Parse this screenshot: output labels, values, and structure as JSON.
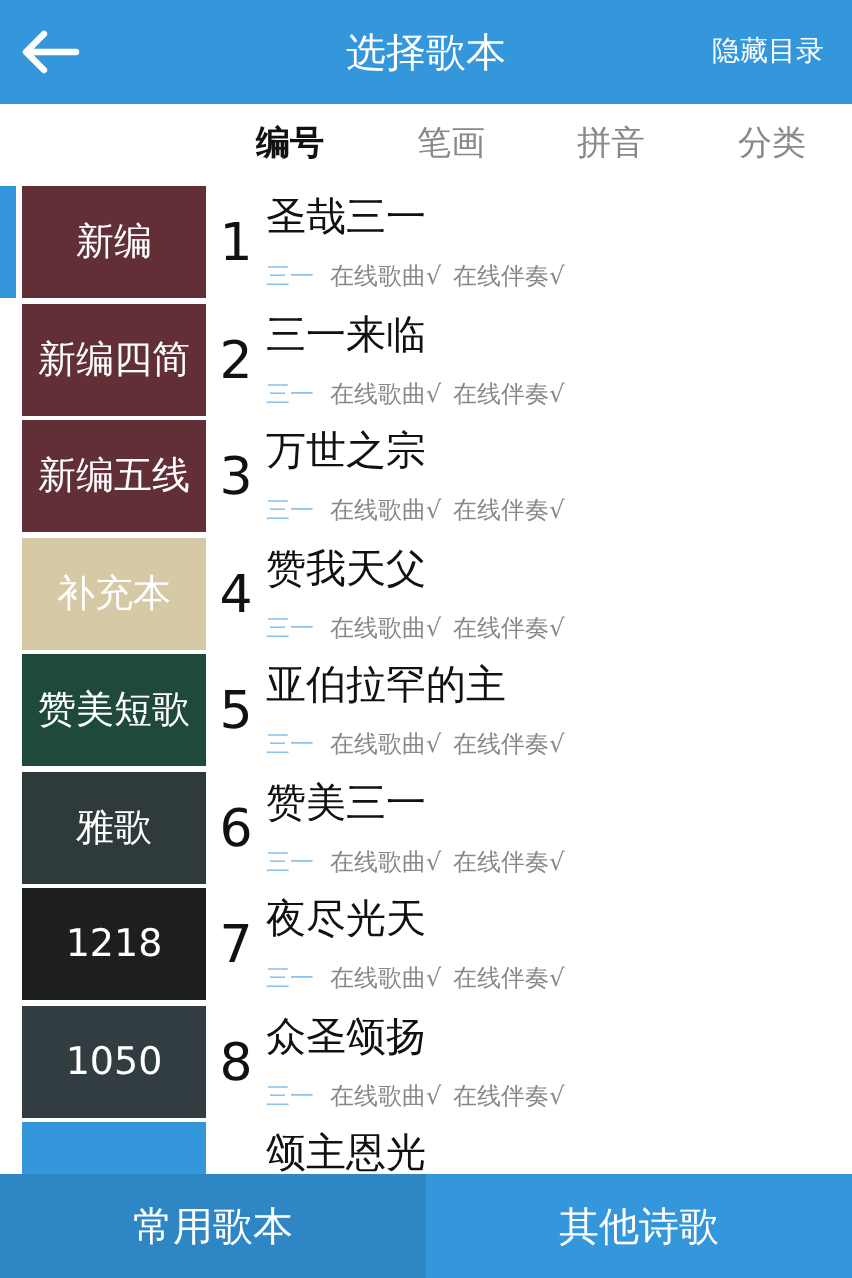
{
  "header": {
    "title": "选择歌本",
    "action": "隐藏目录"
  },
  "sort_tabs": [
    {
      "label": "编号",
      "selected": true
    },
    {
      "label": "笔画",
      "selected": false
    },
    {
      "label": "拼音",
      "selected": false
    },
    {
      "label": "分类",
      "selected": false
    }
  ],
  "books": [
    {
      "label": "新编",
      "color": "#622f37",
      "selected": true
    },
    {
      "label": "新编四简",
      "color": "#622f37",
      "selected": false
    },
    {
      "label": "新编五线",
      "color": "#622f37",
      "selected": false
    },
    {
      "label": "补充本",
      "color": "#d6caa6",
      "selected": false
    },
    {
      "label": "赞美短歌",
      "color": "#1f4a3a",
      "selected": false
    },
    {
      "label": "雅歌",
      "color": "#2f3b3b",
      "selected": false
    },
    {
      "label": "1218",
      "color": "#1d1f1e",
      "selected": false
    },
    {
      "label": "1050",
      "color": "#323d42",
      "selected": false
    },
    {
      "color": "#3597db",
      "selected": false
    }
  ],
  "songs": [
    {
      "number": "1",
      "title": "圣哉三一",
      "category": "三一",
      "song": "在线歌曲√",
      "accompaniment": "在线伴奏√"
    },
    {
      "number": "2",
      "title": "三一来临",
      "category": "三一",
      "song": "在线歌曲√",
      "accompaniment": "在线伴奏√"
    },
    {
      "number": "3",
      "title": "万世之宗",
      "category": "三一",
      "song": "在线歌曲√",
      "accompaniment": "在线伴奏√"
    },
    {
      "number": "4",
      "title": "赞我天父",
      "category": "三一",
      "song": "在线歌曲√",
      "accompaniment": "在线伴奏√"
    },
    {
      "number": "5",
      "title": "亚伯拉罕的主",
      "category": "三一",
      "song": "在线歌曲√",
      "accompaniment": "在线伴奏√"
    },
    {
      "number": "6",
      "title": "赞美三一",
      "category": "三一",
      "song": "在线歌曲√",
      "accompaniment": "在线伴奏√"
    },
    {
      "number": "7",
      "title": "夜尽光天",
      "category": "三一",
      "song": "在线歌曲√",
      "accompaniment": "在线伴奏√"
    },
    {
      "number": "8",
      "title": "众圣颂扬",
      "category": "三一",
      "song": "在线歌曲√",
      "accompaniment": "在线伴奏√"
    },
    {
      "title": "颂主恩光"
    }
  ],
  "bottom_tabs": [
    {
      "label": "常用歌本",
      "selected": true
    },
    {
      "label": "其他诗歌",
      "selected": false
    }
  ]
}
